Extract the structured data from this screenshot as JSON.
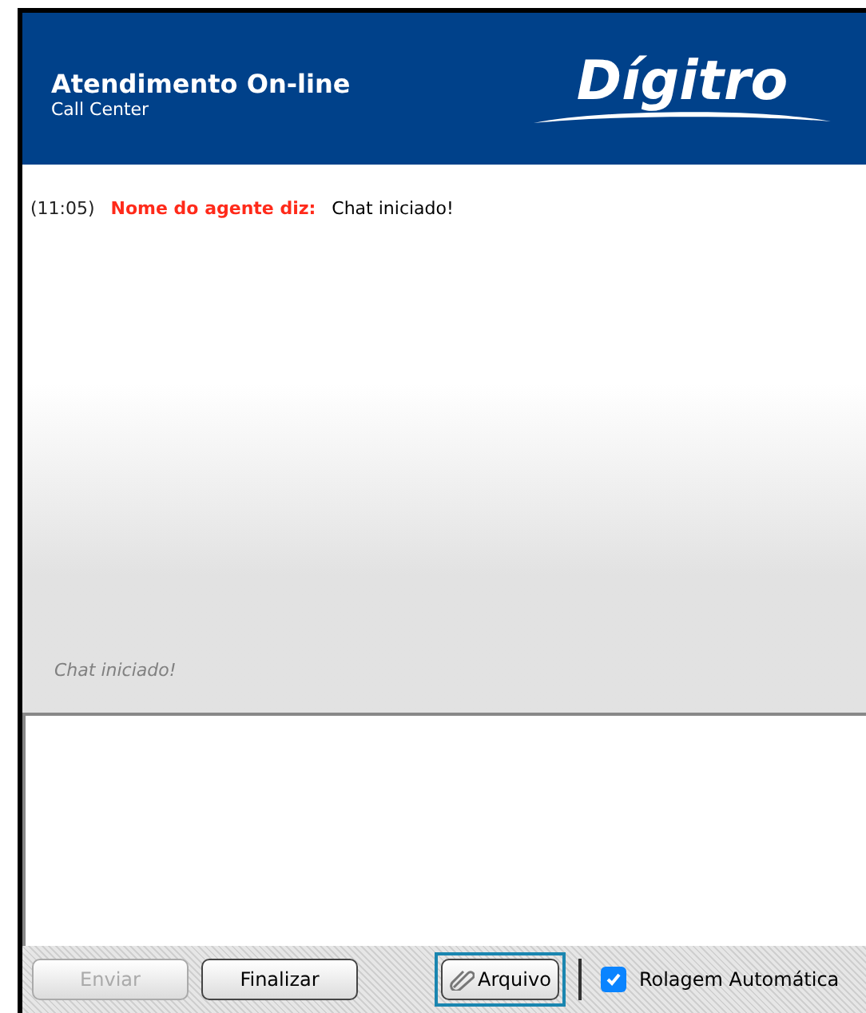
{
  "header": {
    "title": "Atendimento On-line",
    "subtitle": "Call Center",
    "logo": "Dígitro"
  },
  "messages": [
    {
      "time": "(11:05)",
      "sender": "Nome do agente diz:",
      "text": "Chat iniciado!"
    }
  ],
  "status": "Chat iniciado!",
  "buttons": [
    {
      "label": "Enviar",
      "disabled": true
    },
    {
      "label": "Finalizar",
      "disabled": false
    }
  ],
  "attach": {
    "label": "Arquivo",
    "focused": true
  },
  "autoscroll": {
    "label": "Rolagem Automática",
    "checked": true
  }
}
